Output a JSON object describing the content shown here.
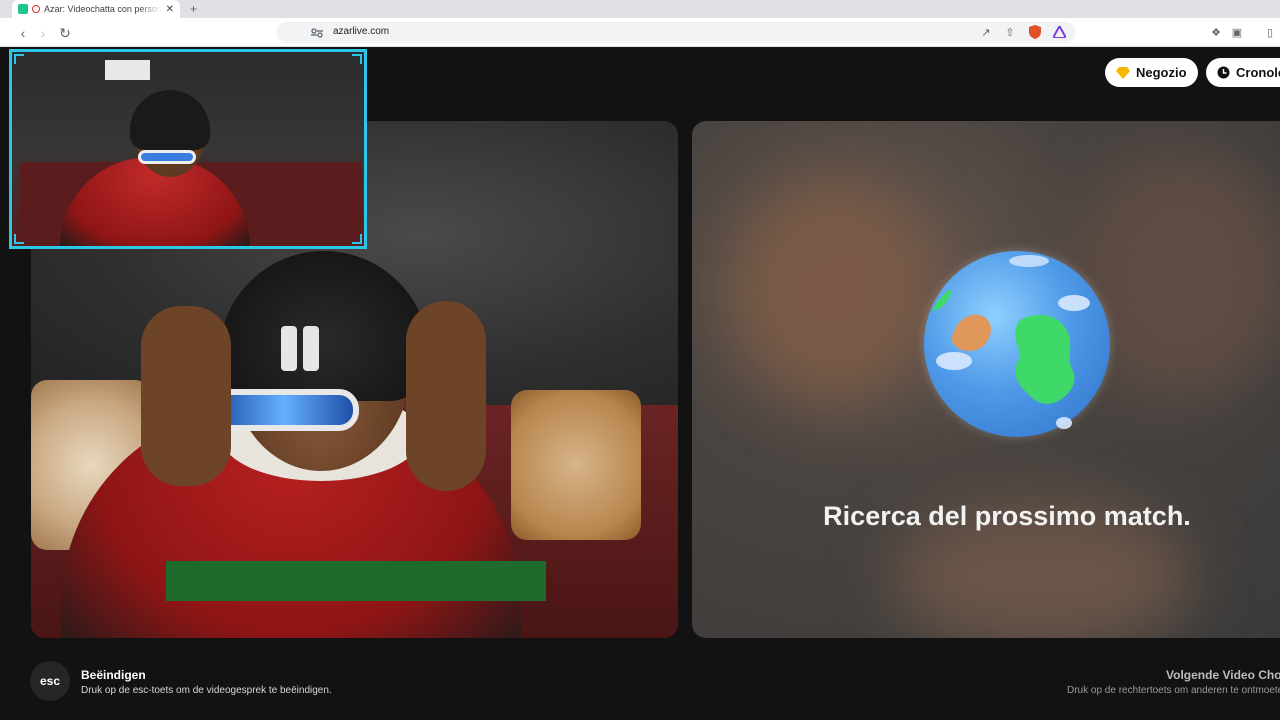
{
  "browser": {
    "tab_title": "Azar: Videochatta con persone",
    "tab_close": "✕",
    "new_tab": "+",
    "url": "azarlive.com"
  },
  "header": {
    "shop_label": "Negozio",
    "history_label": "Cronolog"
  },
  "match": {
    "status_text": "Ricerca del prossimo match."
  },
  "footer": {
    "esc_key": "esc",
    "end_title": "Beëindigen",
    "end_desc": "Druk op de esc-toets om de videogesprek te beëindigen.",
    "next_title": "Volgende Video Cho",
    "next_desc": "Druk op de rechtertoets om anderen te ontmoete"
  },
  "colors": {
    "pip_border": "#2bc6e8",
    "page_bg": "#121212"
  }
}
